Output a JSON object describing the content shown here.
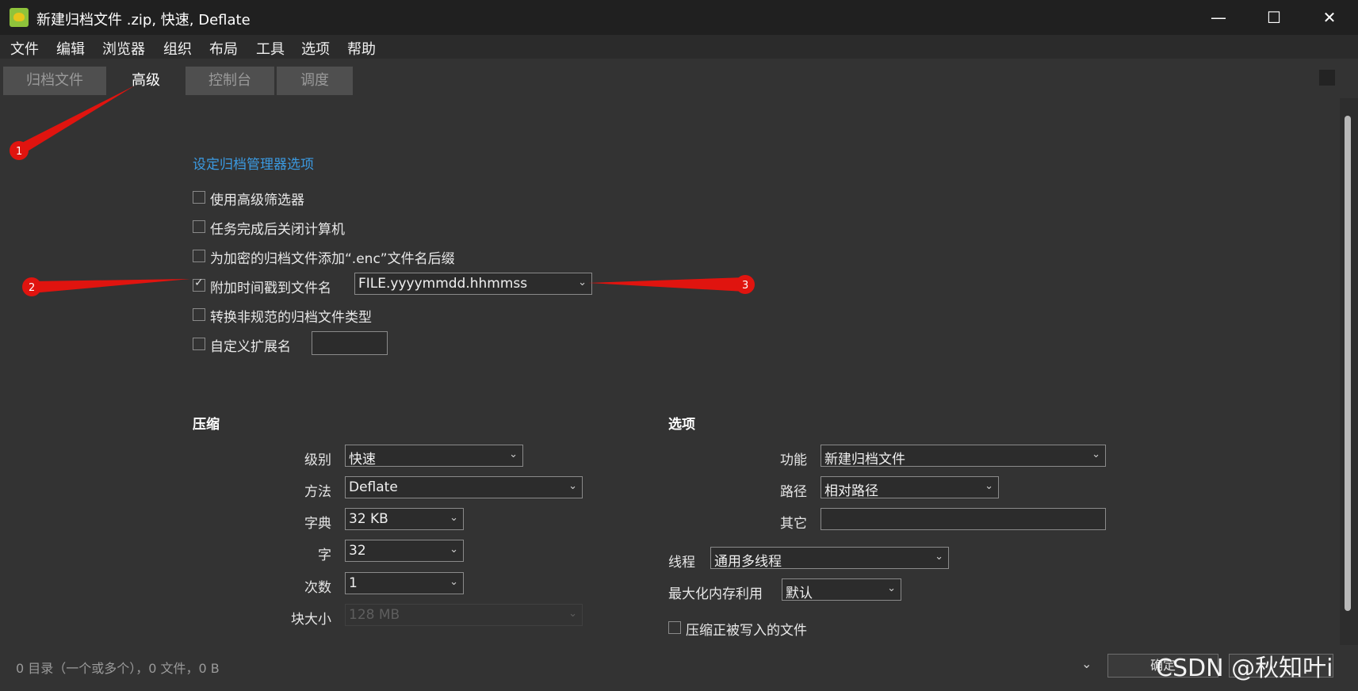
{
  "window": {
    "title": "新建归档文件 .zip, 快速, Deflate",
    "controls": {
      "minimize": "—",
      "maximize": "☐",
      "close": "✕"
    }
  },
  "menu": [
    "文件",
    "编辑",
    "浏览器",
    "组织",
    "布局",
    "工具",
    "选项",
    "帮助"
  ],
  "tabs": [
    {
      "label": "归档文件",
      "active": false
    },
    {
      "label": "高级",
      "active": true
    },
    {
      "label": "控制台",
      "active": false
    },
    {
      "label": "调度",
      "active": false
    }
  ],
  "archive_manager": {
    "heading": "设定归档管理器选项",
    "options": [
      {
        "label": "使用高级筛选器",
        "checked": false
      },
      {
        "label": "任务完成后关闭计算机",
        "checked": false
      },
      {
        "label": "为加密的归档文件添加“.enc”文件名后缀",
        "checked": false
      },
      {
        "label": "附加时间戳到文件名",
        "checked": true
      },
      {
        "label": "转换非规范的归档文件类型",
        "checked": false
      },
      {
        "label": "自定义扩展名",
        "checked": false
      }
    ],
    "timestamp_format": "FILE.yyyymmdd.hhmmss",
    "custom_extension": ""
  },
  "compression": {
    "heading": "压缩",
    "level_label": "级别",
    "level_value": "快速",
    "method_label": "方法",
    "method_value": "Deflate",
    "dictionary_label": "字典",
    "dictionary_value": "32 KB",
    "word_label": "字",
    "word_value": "32",
    "passes_label": "次数",
    "passes_value": "1",
    "block_label": "块大小",
    "block_value": "128 MB"
  },
  "options": {
    "heading": "选项",
    "function_label": "功能",
    "function_value": "新建归档文件",
    "path_label": "路径",
    "path_value": "相对路径",
    "other_label": "其它",
    "other_value": "",
    "threads_label": "线程",
    "threads_value": "通用多线程",
    "memory_label": "最大化内存利用",
    "memory_value": "默认",
    "compress_open_label": "压缩正被写入的文件",
    "compress_open_checked": false
  },
  "status_bar": {
    "summary": "0 目录（一个或多个），0 文件，0 B",
    "ok_label": "确定",
    "cancel_label": ""
  },
  "annotations": [
    "1",
    "2",
    "3"
  ],
  "watermark": "CSDN @秋知叶i",
  "colors": {
    "window_bg": "#333333",
    "titlebar_bg": "#202020",
    "link": "#3b9ae1",
    "annotation_red": "#e0140f"
  },
  "icons": {
    "app": "peazip-app-icon",
    "combo_arrow": "chevron-down-icon"
  }
}
